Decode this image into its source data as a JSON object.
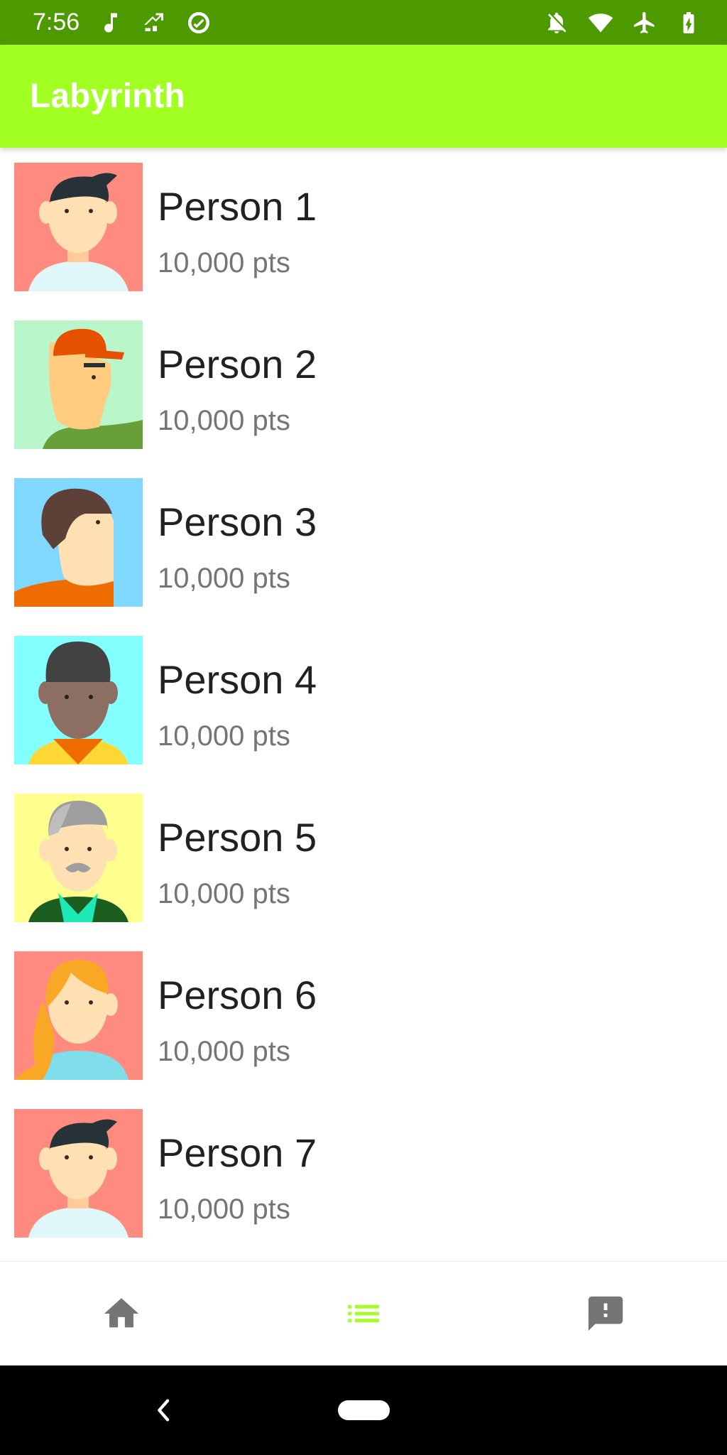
{
  "status_bar": {
    "time": "7:56",
    "left_icons": [
      "music-notification-icon",
      "network-notification-icon",
      "sync-notification-icon"
    ],
    "right_icons": [
      "notifications-off-icon",
      "wifi-icon",
      "airplane-mode-icon",
      "battery-charging-icon"
    ]
  },
  "app_bar": {
    "title": "Labyrinth",
    "color": "#a2ff22"
  },
  "people": [
    {
      "name": "Person 1",
      "points": "10,000 pts",
      "avatar_bg": "#ff8a80"
    },
    {
      "name": "Person 2",
      "points": "10,000 pts",
      "avatar_bg": "#b9f6ca"
    },
    {
      "name": "Person 3",
      "points": "10,000 pts",
      "avatar_bg": "#80d8ff"
    },
    {
      "name": "Person 4",
      "points": "10,000 pts",
      "avatar_bg": "#84ffff"
    },
    {
      "name": "Person 5",
      "points": "10,000 pts",
      "avatar_bg": "#ffff8d"
    },
    {
      "name": "Person 6",
      "points": "10,000 pts",
      "avatar_bg": "#ff8a80"
    },
    {
      "name": "Person 7",
      "points": "10,000 pts",
      "avatar_bg": "#ff8a80"
    }
  ],
  "bottom_nav": {
    "items": [
      {
        "icon": "home-icon",
        "active": false
      },
      {
        "icon": "list-icon",
        "active": true
      },
      {
        "icon": "feedback-icon",
        "active": false
      }
    ],
    "active_color": "#a2ff22",
    "inactive_color": "#757575"
  },
  "system_nav": {
    "items": [
      "back-icon",
      "home-pill"
    ]
  }
}
